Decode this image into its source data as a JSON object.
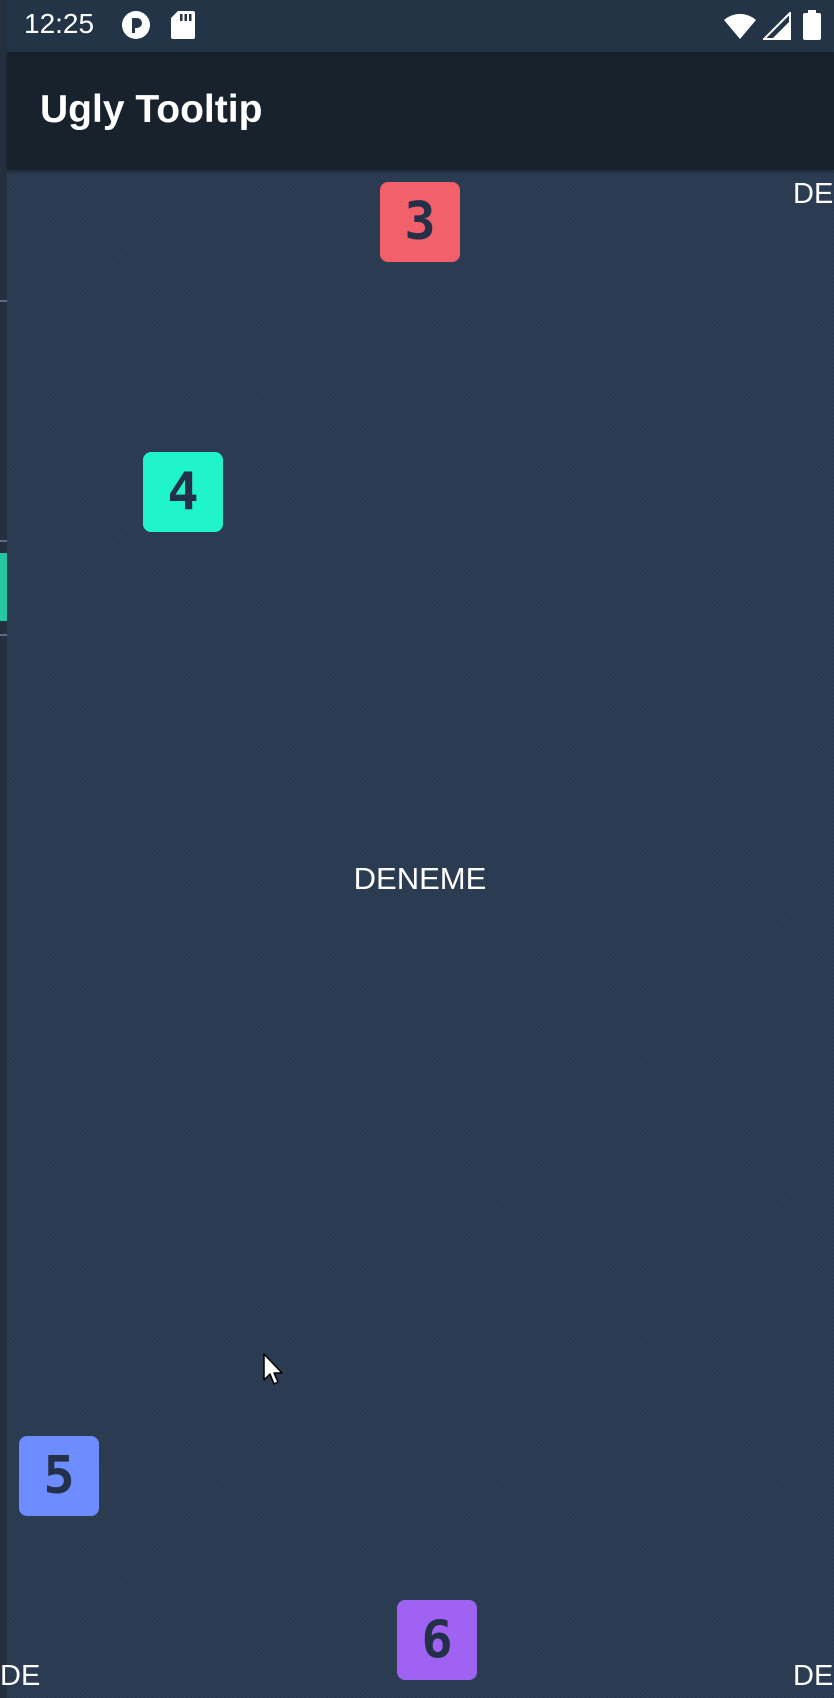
{
  "status_bar": {
    "time": "12:25",
    "icons": [
      "app-notification-icon",
      "sd-card-icon",
      "wifi-icon",
      "signal-icon",
      "battery-icon"
    ]
  },
  "app_bar": {
    "title": "Ugly Tooltip"
  },
  "badges": [
    {
      "label": "3",
      "color": "#f2606a"
    },
    {
      "label": "4",
      "color": "#1ff5c8"
    },
    {
      "label": "5",
      "color": "#6c8cff"
    },
    {
      "label": "6",
      "color": "#a062f2"
    }
  ],
  "content": {
    "center_text": "DENEME",
    "truncated_top_right": "DE",
    "truncated_bottom_left": "DE",
    "truncated_bottom_right": "DE"
  },
  "colors": {
    "background": "#2a3b52",
    "app_bar": "#17222d",
    "status_bar": "#243447"
  }
}
